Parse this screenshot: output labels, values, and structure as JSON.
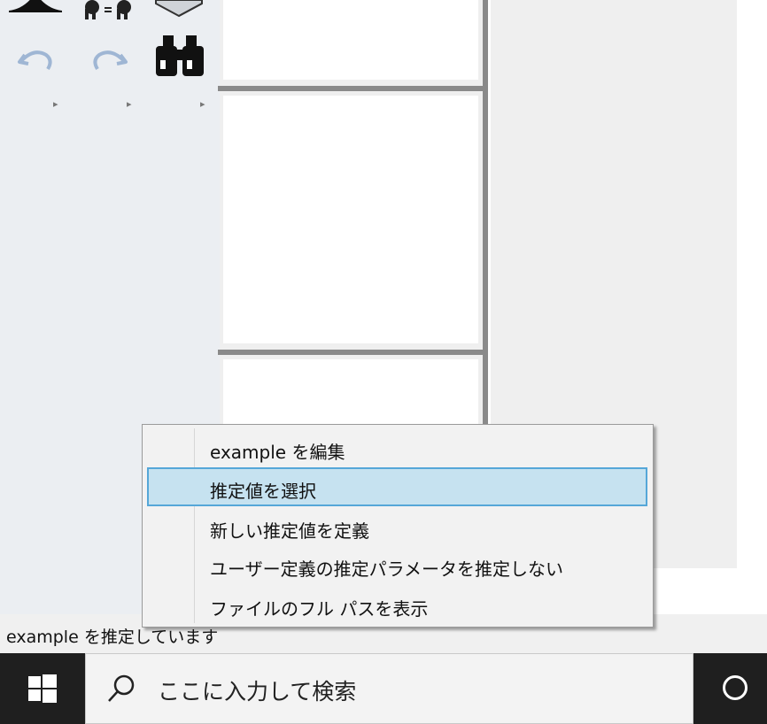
{
  "toolbar": {
    "icons": [
      "distribution-icon",
      "equals-fit-icon",
      "box-icon",
      "undo-icon",
      "redo-icon",
      "binoculars-icon"
    ],
    "more_arrows": [
      "▸",
      "▸",
      "▸"
    ]
  },
  "status_bar": {
    "text": "example を推定しています"
  },
  "context_menu": {
    "items": [
      {
        "label": "example を編集",
        "highlighted": false
      },
      {
        "label": "推定値を選択",
        "highlighted": true
      },
      {
        "label": "新しい推定値を定義",
        "highlighted": false
      },
      {
        "label": "ユーザー定義の推定パラメータを推定しない",
        "highlighted": false
      },
      {
        "label": "ファイルのフル パスを表示",
        "highlighted": false
      }
    ]
  },
  "taskbar": {
    "search_placeholder": "ここに入力して検索"
  },
  "colors": {
    "menu_highlight": "#c6e2f0",
    "menu_highlight_border": "#55a7d8",
    "taskbar": "#1f1f1f"
  }
}
